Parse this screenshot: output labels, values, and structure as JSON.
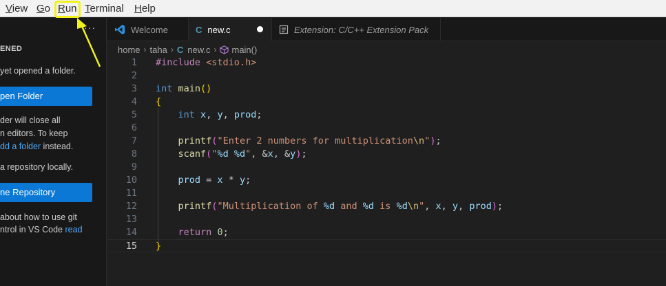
{
  "menubar": {
    "items": [
      {
        "label": "View",
        "mnemonic": "V",
        "rest": "iew"
      },
      {
        "label": "Go",
        "mnemonic": "G",
        "rest": "o"
      },
      {
        "label": "Run",
        "mnemonic": "R",
        "rest": "un"
      },
      {
        "label": "Terminal",
        "mnemonic": "T",
        "rest": "erminal"
      },
      {
        "label": "Help",
        "mnemonic": "H",
        "rest": "elp"
      }
    ]
  },
  "annotation": {
    "highlight_color": "#f2f21a"
  },
  "sidebar": {
    "more_label": "···",
    "section_title": "ENED",
    "line_not_opened": "yet opened a folder.",
    "open_folder_button": "pen Folder",
    "close_info_1": "der will close all",
    "close_info_2": "n editors. To keep",
    "close_info_3_link": "dd a folder",
    "close_info_3_rest": " instead.",
    "repo_info": " a repository locally.",
    "clone_button": "ne Repository",
    "git_info_1": " about how to use git",
    "git_info_2": "ntrol in VS Code ",
    "git_info_link": "read"
  },
  "tabs": [
    {
      "label": "Welcome",
      "icon": "vscode-icon",
      "active": false
    },
    {
      "label": "new.c",
      "icon": "c-file-icon",
      "active": true,
      "dirty": true
    },
    {
      "label": "Extension: C/C++ Extension Pack",
      "icon": "extension-preview-icon",
      "active": false
    }
  ],
  "breadcrumb": {
    "parts": [
      "home",
      "taha",
      "new.c",
      "main()"
    ]
  },
  "editor": {
    "line_numbers": [
      "1",
      "2",
      "3",
      "4",
      "5",
      "6",
      "7",
      "8",
      "9",
      "10",
      "11",
      "12",
      "13",
      "14",
      "15"
    ],
    "current_line": 15,
    "lines": [
      "#include <stdio.h>",
      "",
      "int main()",
      "{",
      "    int x, y, prod;",
      "",
      "    printf(\"Enter 2 numbers for multiplication\\n\");",
      "    scanf(\"%d %d\", &x, &y);",
      "",
      "    prod = x * y;",
      "",
      "    printf(\"Multiplication of %d and %d is %d\\n\", x, y, prod);",
      "",
      "    return 0;",
      "}"
    ]
  },
  "colors": {
    "keyword": "#569cd6",
    "function": "#dcdcaa",
    "string": "#ce9178",
    "variable": "#9cdcfe",
    "number": "#b5cea8",
    "accent_button": "#0a78d4"
  }
}
